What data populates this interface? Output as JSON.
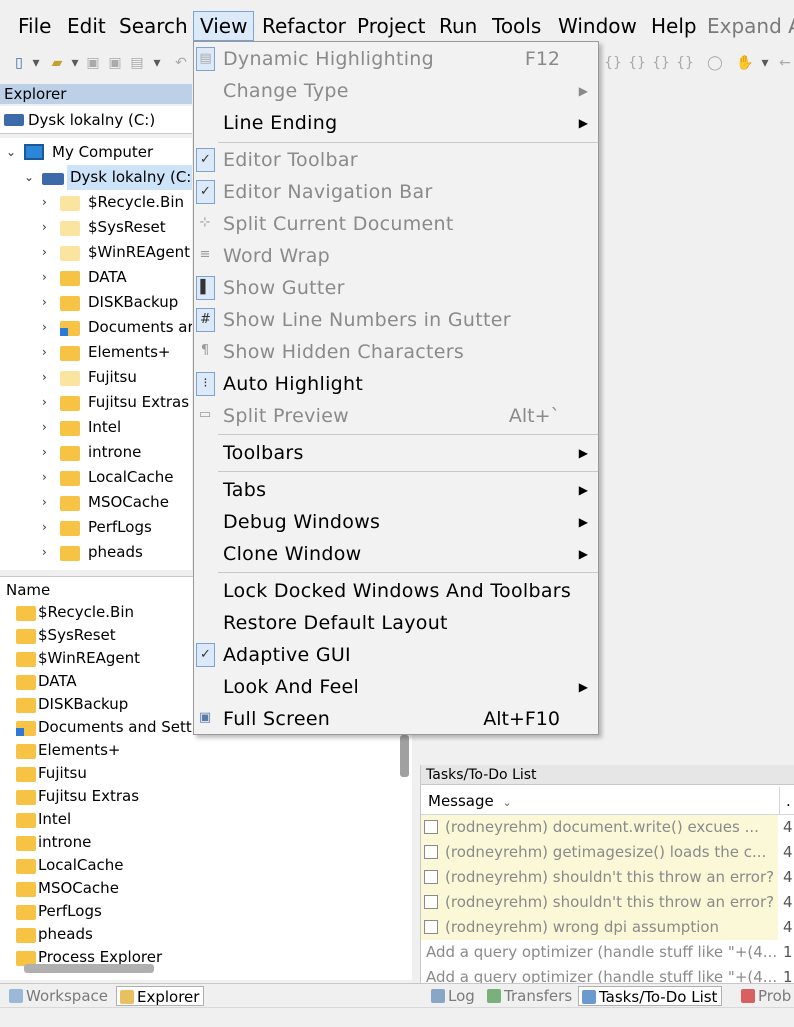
{
  "menubar": {
    "items": [
      "File",
      "Edit",
      "Search",
      "View",
      "Refactor",
      "Project",
      "Run",
      "Tools",
      "Window",
      "Help",
      "Expand A"
    ],
    "active": "View"
  },
  "explorer": {
    "title": "Explorer",
    "drive_selector": "Dysk lokalny (C:)",
    "tree_root": "My Computer",
    "tree_drive": "Dysk lokalny (C:",
    "tree_items": [
      "$Recycle.Bin",
      "$SysReset",
      "$WinREAgent",
      "DATA",
      "DISKBackup",
      "Documents ar",
      "Elements+",
      "Fujitsu",
      "Fujitsu Extras",
      "Intel",
      "introne",
      "LocalCache",
      "MSOCache",
      "PerfLogs",
      "pheads"
    ]
  },
  "filelist": {
    "header": "Name",
    "items": [
      "$Recycle.Bin",
      "$SysReset",
      "$WinREAgent",
      "DATA",
      "DISKBackup",
      "Documents and Setti",
      "Elements+",
      "Fujitsu",
      "Fujitsu Extras",
      "Intel",
      "introne",
      "LocalCache",
      "MSOCache",
      "PerfLogs",
      "pheads",
      "Process Explorer"
    ]
  },
  "view_menu": {
    "items": [
      {
        "label": "Dynamic Highlighting",
        "shortcut": "F12",
        "disabled": true,
        "icon": "highlight-icon"
      },
      {
        "label": "Change Type",
        "disabled": true,
        "submenu": true
      },
      {
        "label": "Line Ending",
        "submenu": true
      },
      {
        "label": "Editor Toolbar",
        "disabled": true,
        "checked": true
      },
      {
        "label": "Editor Navigation Bar",
        "disabled": true,
        "checked": true
      },
      {
        "label": "Split Current Document",
        "disabled": true,
        "icon": "split-icon"
      },
      {
        "label": "Word Wrap",
        "disabled": true,
        "icon": "wrap-icon"
      },
      {
        "label": "Show Gutter",
        "disabled": true,
        "checked": true,
        "icon": "gutter-icon"
      },
      {
        "label": "Show Line Numbers in Gutter",
        "disabled": true,
        "checked": true,
        "icon": "hash-icon"
      },
      {
        "label": "Show Hidden Characters",
        "disabled": true,
        "icon": "pilcrow-icon"
      },
      {
        "label": "Auto Highlight",
        "checked": true,
        "icon": "auto-highlight-icon"
      },
      {
        "label": "Split Preview",
        "shortcut": "Alt+`",
        "disabled": true,
        "icon": "preview-icon"
      },
      {
        "label": "Toolbars",
        "submenu": true
      },
      {
        "label": "Tabs",
        "submenu": true
      },
      {
        "label": "Debug Windows",
        "submenu": true
      },
      {
        "label": "Clone Window",
        "submenu": true
      },
      {
        "label": "Lock Docked Windows And Toolbars"
      },
      {
        "label": "Restore Default Layout"
      },
      {
        "label": "Adaptive GUI",
        "checked": true
      },
      {
        "label": "Look And Feel",
        "submenu": true
      },
      {
        "label": "Full Screen",
        "shortcut": "Alt+F10",
        "icon": "fullscreen-icon"
      }
    ]
  },
  "tasks": {
    "title": "Tasks/To-Do List",
    "column": "Message",
    "column_extra": ".",
    "rows": [
      {
        "message": "(rodneyrehm) document.write() excues ...",
        "num": "4"
      },
      {
        "message": "(rodneyrehm) getimagesize() loads the c...",
        "num": "4"
      },
      {
        "message": "(rodneyrehm) shouldn't this throw an error?",
        "num": "4"
      },
      {
        "message": "(rodneyrehm) shouldn't this throw an error?",
        "num": "4"
      },
      {
        "message": "(rodneyrehm) wrong dpi assumption",
        "num": "4"
      },
      {
        "message": "Add a query optimizer (handle stuff like \"+(4...",
        "num": "1"
      },
      {
        "message": "Add a query optimizer (handle stuff like \"+(4...",
        "num": "1"
      }
    ]
  },
  "bottom_tabs": [
    "Workspace",
    "Explorer",
    "Log",
    "Transfers",
    "Tasks/To-Do List",
    "Prob"
  ],
  "colors": {
    "accent": "#dce9f8",
    "accent_border": "#7da2ce",
    "selection": "#cde3f8",
    "folder": "#f6c344",
    "task_highlight": "#fbf8d8"
  }
}
